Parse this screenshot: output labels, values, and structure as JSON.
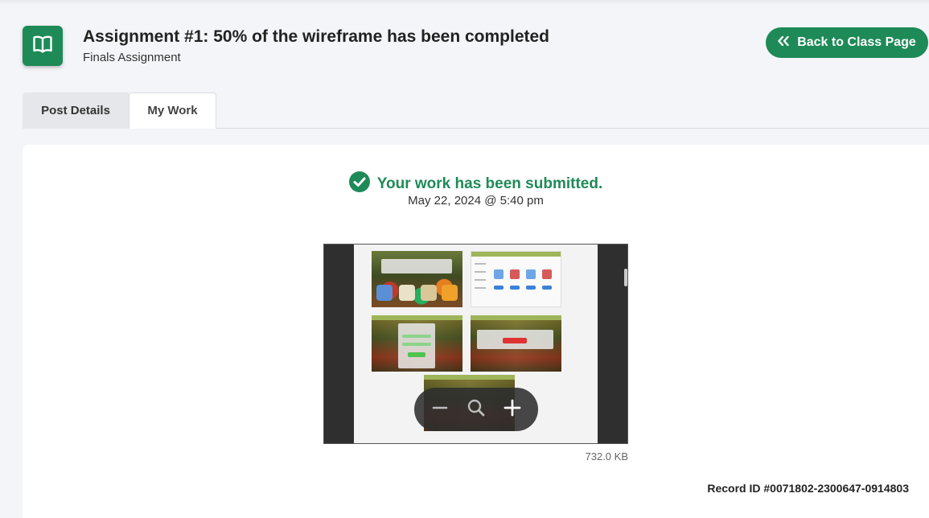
{
  "header": {
    "title": "Assignment #1: 50% of the wireframe has been completed",
    "subtitle": "Finals Assignment",
    "icon": "open-book-icon",
    "back_button": {
      "label": "Back to Class Page",
      "icon": "double-chevron-left-icon"
    }
  },
  "tabs": [
    {
      "label": "Post Details",
      "active": false
    },
    {
      "label": "My Work",
      "active": true
    }
  ],
  "submission": {
    "status_text": "Your work has been submitted.",
    "status_icon": "check-circle-icon",
    "date": "May 22, 2024 @ 5:40 pm",
    "file_size": "732.0 KB",
    "record_id": "Record ID #0071802-2300647-0914803"
  },
  "viewer": {
    "zoom_controls": [
      "zoom-out-icon",
      "zoom-reset-icon",
      "zoom-in-icon"
    ]
  },
  "colors": {
    "accent": "#1e8a57",
    "background": "#f4f5f9",
    "card": "#ffffff"
  }
}
